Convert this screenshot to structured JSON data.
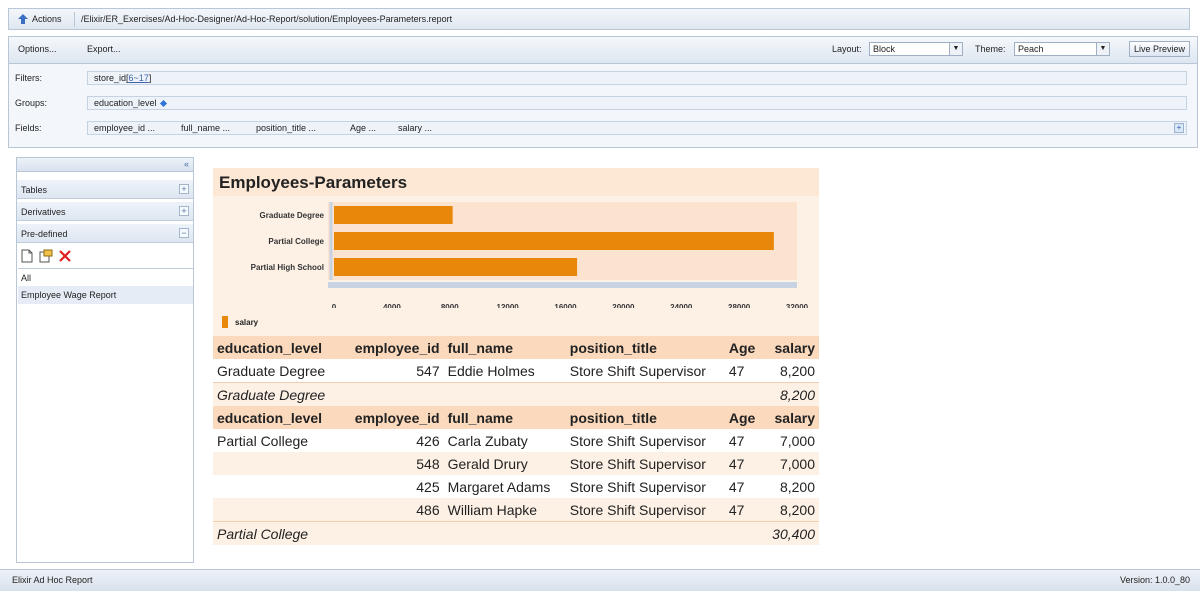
{
  "pathbar": {
    "actions_label": "Actions",
    "path": "/Elixir/ER_Exercises/Ad-Hoc-Designer/Ad-Hoc-Report/solution/Employees-Parameters.report"
  },
  "toolbar": {
    "options_label": "Options...",
    "export_label": "Export...",
    "layout_label": "Layout:",
    "layout_value": "Block",
    "theme_label": "Theme:",
    "theme_value": "Peach",
    "live_preview_label": "Live Preview"
  },
  "filters": {
    "label": "Filters:",
    "field": "store_id",
    "open": "[",
    "range": "6~17",
    "close": "]"
  },
  "groups": {
    "label": "Groups:",
    "value": "education_level"
  },
  "fields": {
    "label": "Fields:",
    "items": [
      "employee_id ...",
      "full_name ...",
      "position_title ...",
      "Age ...",
      "salary ..."
    ]
  },
  "sidebar": {
    "collapse_glyph": "«",
    "sections": [
      {
        "label": "Tables",
        "toggle": "+"
      },
      {
        "label": "Derivatives",
        "toggle": "+"
      },
      {
        "label": "Pre-defined",
        "toggle": "−"
      }
    ],
    "list": [
      "All",
      "Employee Wage Report"
    ]
  },
  "report": {
    "title": "Employees-Parameters",
    "legend_label": "salary",
    "columns": [
      "education_level",
      "employee_id",
      "full_name",
      "position_title",
      "Age",
      "salary"
    ],
    "groups": [
      {
        "name": "Graduate Degree",
        "rows": [
          {
            "education_level": "Graduate Degree",
            "employee_id": "547",
            "full_name": "Eddie Holmes",
            "position_title": "Store Shift Supervisor",
            "age": "47",
            "salary": "8,200"
          }
        ],
        "total_label": "Graduate Degree",
        "total": "8,200"
      },
      {
        "name": "Partial College",
        "rows": [
          {
            "education_level": "Partial College",
            "employee_id": "426",
            "full_name": "Carla Zubaty",
            "position_title": "Store Shift Supervisor",
            "age": "47",
            "salary": "7,000"
          },
          {
            "education_level": "",
            "employee_id": "548",
            "full_name": "Gerald Drury",
            "position_title": "Store Shift Supervisor",
            "age": "47",
            "salary": "7,000"
          },
          {
            "education_level": "",
            "employee_id": "425",
            "full_name": "Margaret Adams",
            "position_title": "Store Shift Supervisor",
            "age": "47",
            "salary": "8,200"
          },
          {
            "education_level": "",
            "employee_id": "486",
            "full_name": "William Hapke",
            "position_title": "Store Shift Supervisor",
            "age": "47",
            "salary": "8,200"
          }
        ],
        "total_label": "Partial College",
        "total": "30,400"
      }
    ]
  },
  "chart_data": {
    "type": "bar",
    "orientation": "horizontal",
    "categories": [
      "Graduate Degree",
      "Partial College",
      "Partial High School"
    ],
    "series": [
      {
        "name": "salary",
        "values": [
          8200,
          30400,
          16800
        ],
        "color": "#e8870a"
      }
    ],
    "xlim": [
      0,
      32000
    ],
    "xticks": [
      0,
      4000,
      8000,
      12000,
      16000,
      20000,
      24000,
      28000,
      32000
    ],
    "legend_position": "bottom-left"
  },
  "statusbar": {
    "left": "Elixir Ad Hoc Report",
    "right": "Version: 1.0.0_80"
  },
  "colors": {
    "bar": "#e8870a",
    "header_bg": "#fbd9bd",
    "alt_row": "#fdf1e6",
    "title_bg": "#fde8d6",
    "chrome": "#dfe7f1"
  }
}
